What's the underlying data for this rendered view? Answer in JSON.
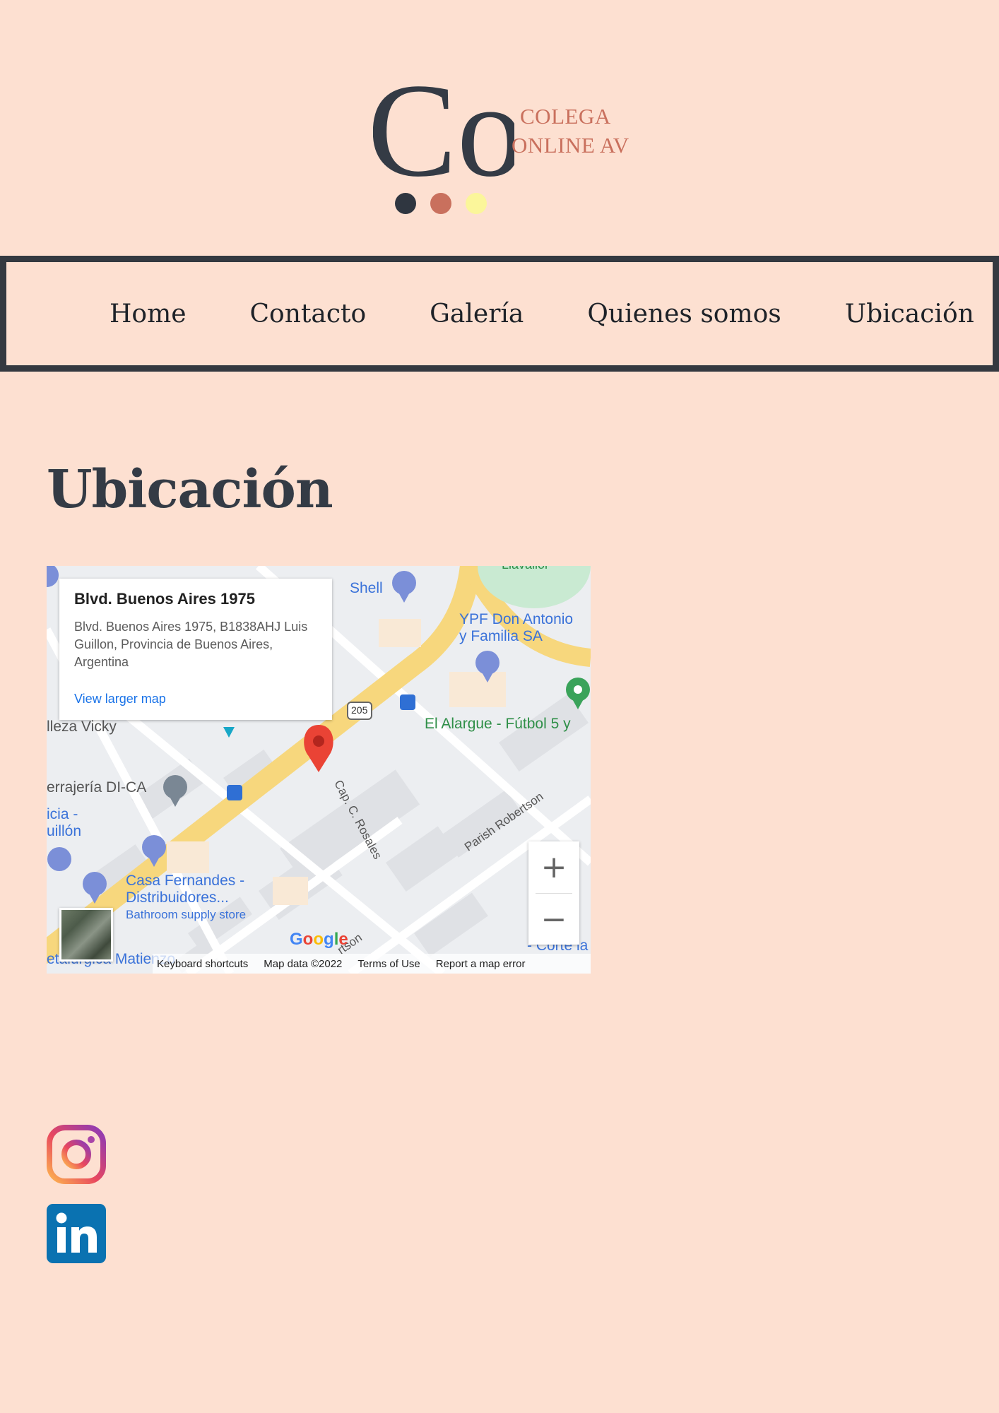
{
  "logo": {
    "monogram": "Co",
    "line1": "COLEGA",
    "line2": "ONLINE AV",
    "dot_colors": [
      "#2f3640",
      "#c9705d",
      "#fbf69a"
    ]
  },
  "nav": {
    "items": [
      "Home",
      "Contacto",
      "Galería",
      "Quienes somos",
      "Ubicación"
    ]
  },
  "page": {
    "title": "Ubicación"
  },
  "map": {
    "info_title": "Blvd. Buenos Aires 1975",
    "info_address": "Blvd. Buenos Aires 1975, B1838AHJ Luis Guillon, Provincia de Buenos Aires, Argentina",
    "info_link": "View larger map",
    "labels": {
      "shell": "Shell",
      "ypf": "YPF Don Antonio\ny Familia SA",
      "alargue": "El Alargue - Fútbol 5 y",
      "vicky": "lleza Vicky",
      "ferreteria": "errajería DI-CA",
      "icia": "icia -\nuillón",
      "casa": "Casa Fernandes -\nDistribuidores...",
      "casa_sub": "Bathroom supply store",
      "rosales": "Cap. C. Rosales",
      "parish": "Parish Robertson",
      "route": "205",
      "llavallol": "Llavallol",
      "metalurgica": "etalúrgica Matienzo",
      "corte": "- Corte la",
      "rtson": "rtson"
    },
    "zoom_in": "+",
    "zoom_out": "−",
    "google": "Google",
    "attribution": [
      "Keyboard shortcuts",
      "Map data ©2022",
      "Terms of Use",
      "Report a map error"
    ]
  },
  "social": {
    "instagram_icon": "instagram-icon",
    "linkedin_icon": "linkedin-icon"
  }
}
